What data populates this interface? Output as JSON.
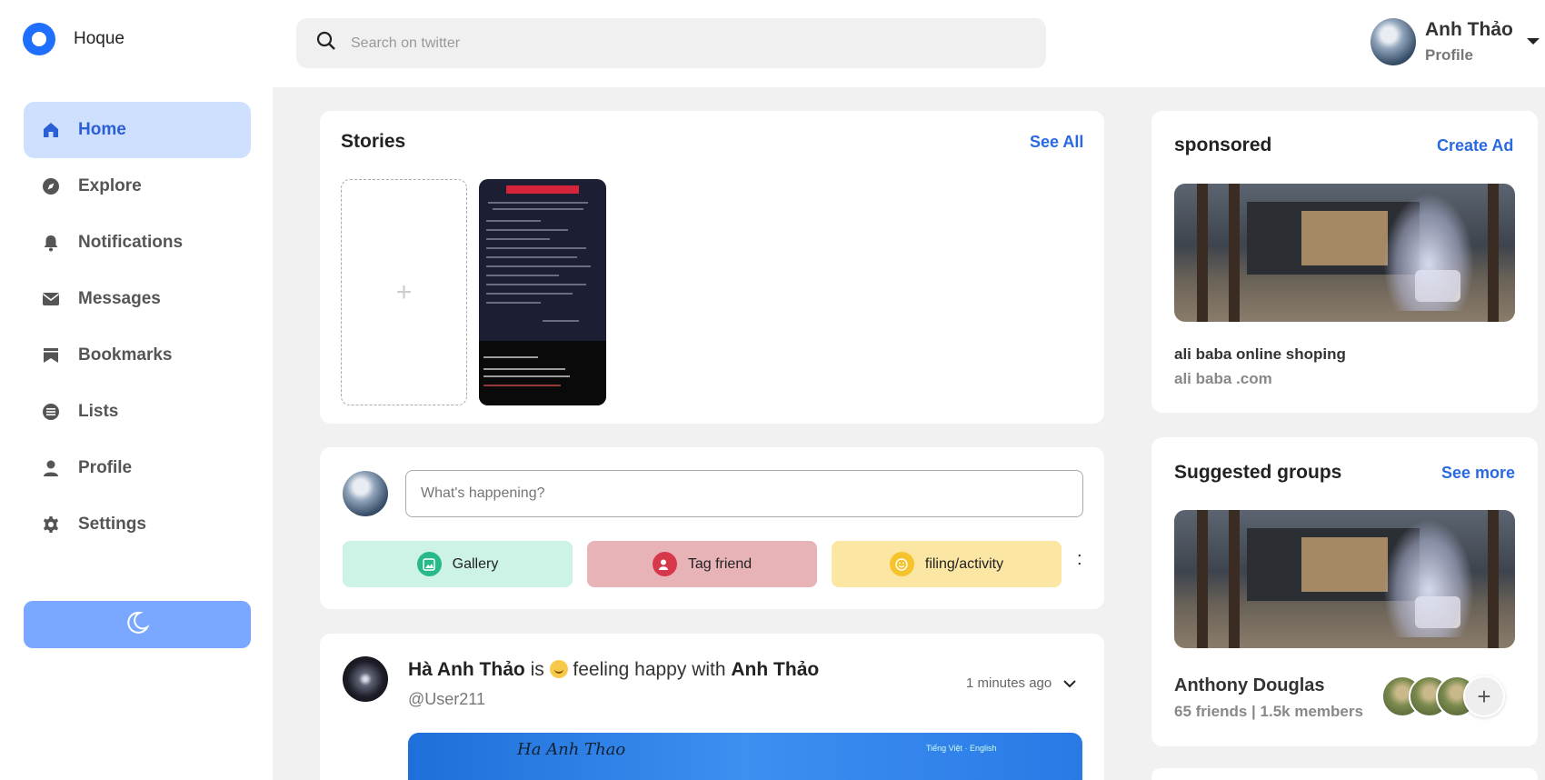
{
  "brand": {
    "name": "Hoque"
  },
  "sidebar": {
    "items": [
      {
        "label": "Home",
        "icon": "home-icon",
        "active": true
      },
      {
        "label": "Explore",
        "icon": "compass-icon"
      },
      {
        "label": "Notifications",
        "icon": "bell-icon"
      },
      {
        "label": "Messages",
        "icon": "envelope-icon"
      },
      {
        "label": "Bookmarks",
        "icon": "bookmark-icon"
      },
      {
        "label": "Lists",
        "icon": "list-icon"
      },
      {
        "label": "Profile",
        "icon": "user-icon"
      },
      {
        "label": "Settings",
        "icon": "gear-icon"
      }
    ],
    "theme_toggle_icon": "moon-icon"
  },
  "search": {
    "placeholder": "Search on twitter"
  },
  "user": {
    "name": "Anh Thảo",
    "subtitle": "Profile"
  },
  "stories": {
    "title": "Stories",
    "see_all": "See All",
    "add_symbol": "+"
  },
  "composer": {
    "placeholder": "What's happening?",
    "actions": [
      {
        "label": "Gallery",
        "color": "#cdf2e6",
        "icon_color": "#27b98a"
      },
      {
        "label": "Tag friend",
        "color": "#e8b3b7",
        "icon_color": "#d7374a"
      },
      {
        "label": "filing/activity",
        "color": "#fbe6a3",
        "icon_color": "#f5c32c"
      }
    ],
    "more": ":"
  },
  "post": {
    "author": "Hà Anh Thảo",
    "verb": "is",
    "feeling": "feeling happy with",
    "tagged": "Anh Thảo",
    "handle": "@User211",
    "time": "1 minutes ago"
  },
  "sponsored": {
    "title": "sponsored",
    "action": "Create Ad",
    "ad_name": "ali baba online shoping",
    "ad_url": "ali baba .com"
  },
  "groups": {
    "title": "Suggested groups",
    "action": "See more",
    "group_name": "Anthony Douglas",
    "meta": "65 friends | 1.5k members"
  },
  "colors": {
    "accent": "#2a6ae0",
    "active_nav_bg": "#cfe0ff",
    "theme_button": "#7aa7ff"
  }
}
